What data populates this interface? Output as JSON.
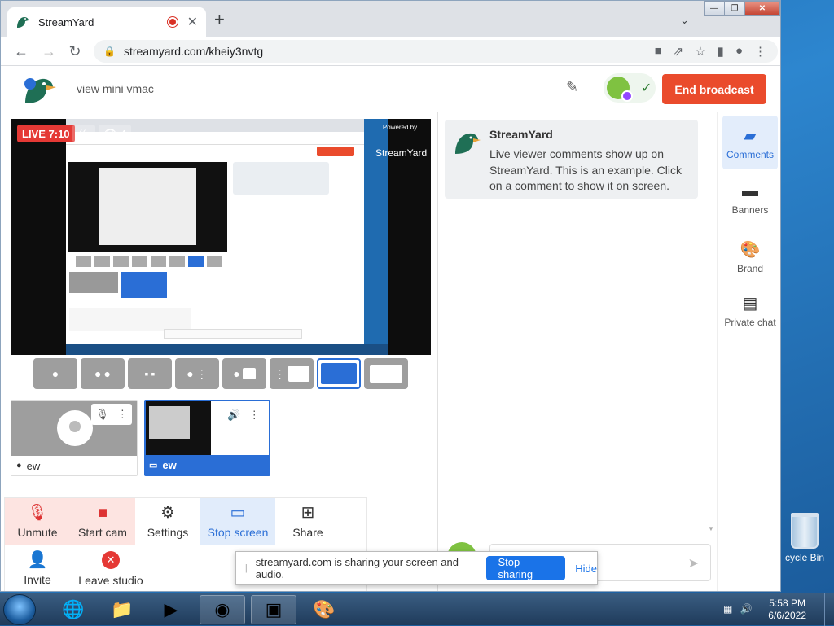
{
  "browser": {
    "tab_title": "StreamYard",
    "tab_close": "✕",
    "new_tab": "+",
    "tab_menu": "⌄",
    "url": "streamyard.com/kheiy3nvtg",
    "window_min": "—",
    "window_max": "❐",
    "window_close": "✕"
  },
  "header": {
    "broadcast_title": "view mini vmac",
    "end_label": "End broadcast"
  },
  "stage": {
    "live_label": "LIVE 7:10",
    "viewers": "4",
    "powered_by": "Powered by",
    "powered_brand": "StreamYard"
  },
  "tiles": [
    {
      "name": "ew"
    },
    {
      "name": "ew"
    }
  ],
  "controls": {
    "unmute": "Unmute",
    "start_cam": "Start cam",
    "settings": "Settings",
    "stop_screen": "Stop screen",
    "share": "Share",
    "invite": "Invite",
    "leave": "Leave studio"
  },
  "comment": {
    "name": "StreamYard",
    "text": "Live viewer comments show up on StreamYard. This is an example. Click on a comment to show it on screen."
  },
  "sidebar": {
    "items": [
      {
        "label": "Comments"
      },
      {
        "label": "Banners"
      },
      {
        "label": "Brand"
      },
      {
        "label": "Private chat"
      }
    ]
  },
  "share_bar": {
    "message": "streamyard.com is sharing your screen and audio.",
    "stop_label": "Stop sharing",
    "hide_label": "Hide"
  },
  "desktop": {
    "recycle_label": "cycle Bin"
  },
  "taskbar": {
    "time": "5:58 PM",
    "date": "6/6/2022"
  },
  "colors": {
    "accent": "#2a6ed6",
    "end_broadcast": "#ea4b2c",
    "live": "#e53935"
  },
  "icons": [
    "mic-off-icon",
    "camera-off-icon",
    "gear-icon",
    "monitor-icon",
    "share-icon",
    "add-person-icon",
    "close-circle-icon",
    "comment-icon",
    "banner-icon",
    "palette-icon",
    "chat-icon",
    "pencil-icon",
    "send-icon"
  ]
}
